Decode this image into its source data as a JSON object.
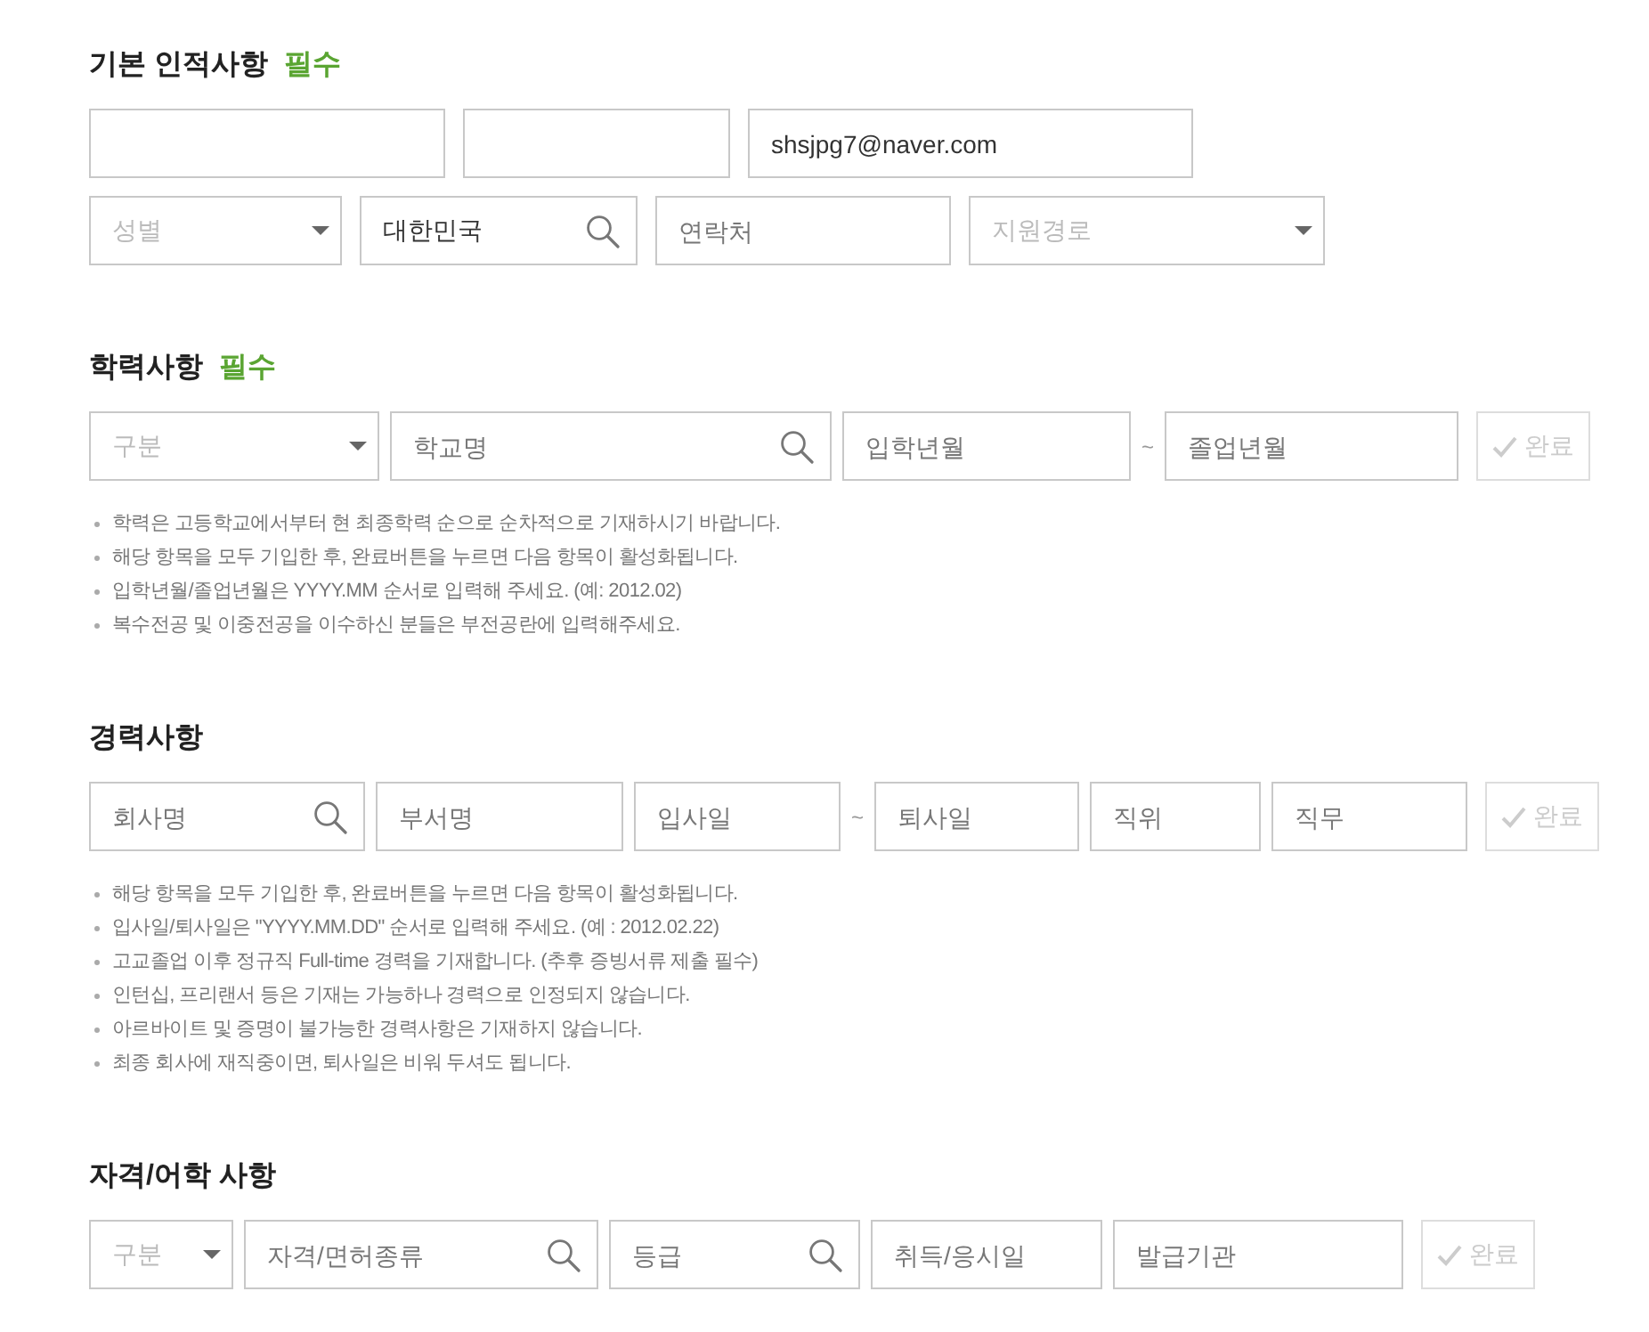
{
  "sections": [
    {
      "title": "기본 인적사항",
      "badge": "필수",
      "rows": [
        {
          "fields": [
            {
              "kind": "text"
            },
            {
              "kind": "text"
            },
            {
              "kind": "text",
              "value": "shsjpg7@naver.com"
            }
          ]
        },
        {
          "fields": [
            {
              "kind": "select",
              "placeholder": "성별"
            },
            {
              "kind": "search",
              "value": "대한민국"
            },
            {
              "kind": "text",
              "placeholder": "연락처"
            },
            {
              "kind": "select",
              "placeholder": "지원경로"
            }
          ]
        }
      ]
    },
    {
      "title": "학력사항",
      "badge": "필수",
      "rows": [
        {
          "fields": [
            {
              "kind": "select",
              "placeholder": "구분"
            },
            {
              "kind": "search",
              "placeholder": "학교명"
            },
            {
              "kind": "text",
              "placeholder": "입학년월"
            },
            {
              "kind": "separator",
              "text": "~"
            },
            {
              "kind": "text",
              "placeholder": "졸업년월"
            },
            {
              "kind": "button",
              "label": "완료",
              "disabled": true
            }
          ]
        }
      ],
      "notes": [
        "학력은 고등학교에서부터 현 최종학력 순으로 순차적으로 기재하시기 바랍니다.",
        "해당 항목을 모두 기입한 후, 완료버튼을 누르면 다음 항목이 활성화됩니다.",
        "입학년월/졸업년월은 YYYY.MM 순서로 입력해 주세요. (예: 2012.02)",
        "복수전공 및 이중전공을 이수하신 분들은 부전공란에 입력해주세요."
      ]
    },
    {
      "title": "경력사항",
      "rows": [
        {
          "fields": [
            {
              "kind": "search",
              "placeholder": "회사명"
            },
            {
              "kind": "text",
              "placeholder": "부서명"
            },
            {
              "kind": "text",
              "placeholder": "입사일"
            },
            {
              "kind": "separator",
              "text": "~"
            },
            {
              "kind": "text",
              "placeholder": "퇴사일"
            },
            {
              "kind": "text",
              "placeholder": "직위"
            },
            {
              "kind": "text",
              "placeholder": "직무"
            },
            {
              "kind": "button",
              "label": "완료",
              "disabled": true
            }
          ]
        }
      ],
      "notes": [
        "해당 항목을 모두 기입한 후, 완료버튼을 누르면 다음 항목이 활성화됩니다.",
        "입사일/퇴사일은 \"YYYY.MM.DD\" 순서로 입력해 주세요. (예 : 2012.02.22)",
        "고교졸업 이후 정규직 Full-time 경력을 기재합니다. (추후 증빙서류 제출 필수)",
        "인턴십, 프리랜서 등은 기재는 가능하나 경력으로 인정되지 않습니다.",
        "아르바이트 및 증명이 불가능한 경력사항은 기재하지 않습니다.",
        "최종 회사에 재직중이면, 퇴사일은 비워 두셔도 됩니다."
      ]
    },
    {
      "title": "자격/어학 사항",
      "rows": [
        {
          "fields": [
            {
              "kind": "select",
              "placeholder": "구분"
            },
            {
              "kind": "search",
              "placeholder": "자격/면허종류"
            },
            {
              "kind": "search",
              "placeholder": "등급"
            },
            {
              "kind": "text",
              "placeholder": "취득/응시일"
            },
            {
              "kind": "text",
              "placeholder": "발급기관"
            },
            {
              "kind": "button",
              "label": "완료",
              "disabled": true
            }
          ]
        }
      ]
    }
  ]
}
